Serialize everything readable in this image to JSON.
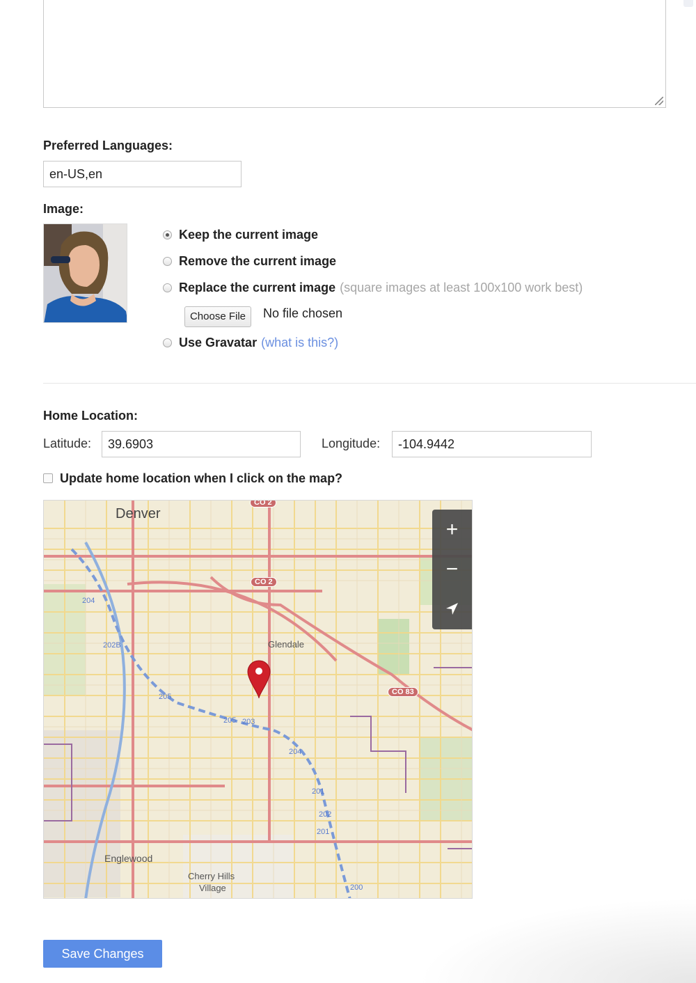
{
  "bio_textarea": {
    "value": ""
  },
  "languages": {
    "label": "Preferred Languages:",
    "value": "en-US,en"
  },
  "image": {
    "label": "Image:",
    "options": [
      {
        "label": "Keep the current image",
        "checked": true
      },
      {
        "label": "Remove the current image",
        "checked": false
      },
      {
        "label": "Replace the current image",
        "hint": "(square images at least 100x100 work best)",
        "checked": false
      },
      {
        "label": "Use Gravatar",
        "link": "(what is this?)",
        "checked": false
      }
    ],
    "file_button": "Choose File",
    "file_status": "No file chosen"
  },
  "home_location": {
    "label": "Home Location:",
    "latitude_label": "Latitude:",
    "latitude": "39.6903",
    "longitude_label": "Longitude:",
    "longitude": "-104.9442",
    "update_checkbox_label": "Update home location when I click on the map?",
    "update_checked": false
  },
  "map": {
    "place_labels": [
      "Denver",
      "Glendale",
      "Englewood",
      "Cherry Hills",
      "Village"
    ],
    "route_shields": [
      "CO 2",
      "CO 2",
      "CO 83"
    ],
    "highway_labels": [
      "204",
      "205",
      "202B",
      "205",
      "203",
      "204",
      "201",
      "202",
      "201",
      "200"
    ],
    "controls": {
      "zoom_in": "+",
      "zoom_out": "−"
    },
    "marker_icon": "map-pin-icon",
    "locate_icon": "location-arrow-icon"
  },
  "colors": {
    "save_button": "#5b8de6",
    "link": "#6a8fe0",
    "marker": "#d0202a",
    "road_major": "#e08a8a",
    "road_minor": "#f3d888"
  },
  "save_button": "Save Changes"
}
